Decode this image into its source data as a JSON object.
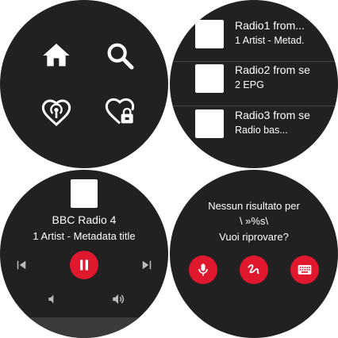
{
  "colors": {
    "watch_bg": "#212121",
    "accent": "#e0182d",
    "text": "#ffffff"
  },
  "home_screen": {
    "icons": [
      "home-icon",
      "search-icon",
      "podcast-heart-icon",
      "heart-lock-icon"
    ]
  },
  "station_list": {
    "items": [
      {
        "title": "Radio1 from...",
        "subtitle": "1 Artist - Metad."
      },
      {
        "title": "Radio2 from se",
        "subtitle": "2 EPG"
      },
      {
        "title": "Radio3 from se",
        "subtitle": "Radio bas..."
      }
    ]
  },
  "player": {
    "station": "BBC Radio 4",
    "metadata": "1 Artist - Metadata title",
    "controls": [
      "skip-previous-icon",
      "pause-icon",
      "skip-next-icon",
      "volume-down-icon",
      "volume-up-icon"
    ]
  },
  "no_results": {
    "line1": "Nessun risultato per",
    "line2": "\\ »%s\\",
    "line3": "Vuoi riprovare?",
    "actions": [
      "microphone-icon",
      "handwriting-icon",
      "keyboard-icon"
    ]
  }
}
